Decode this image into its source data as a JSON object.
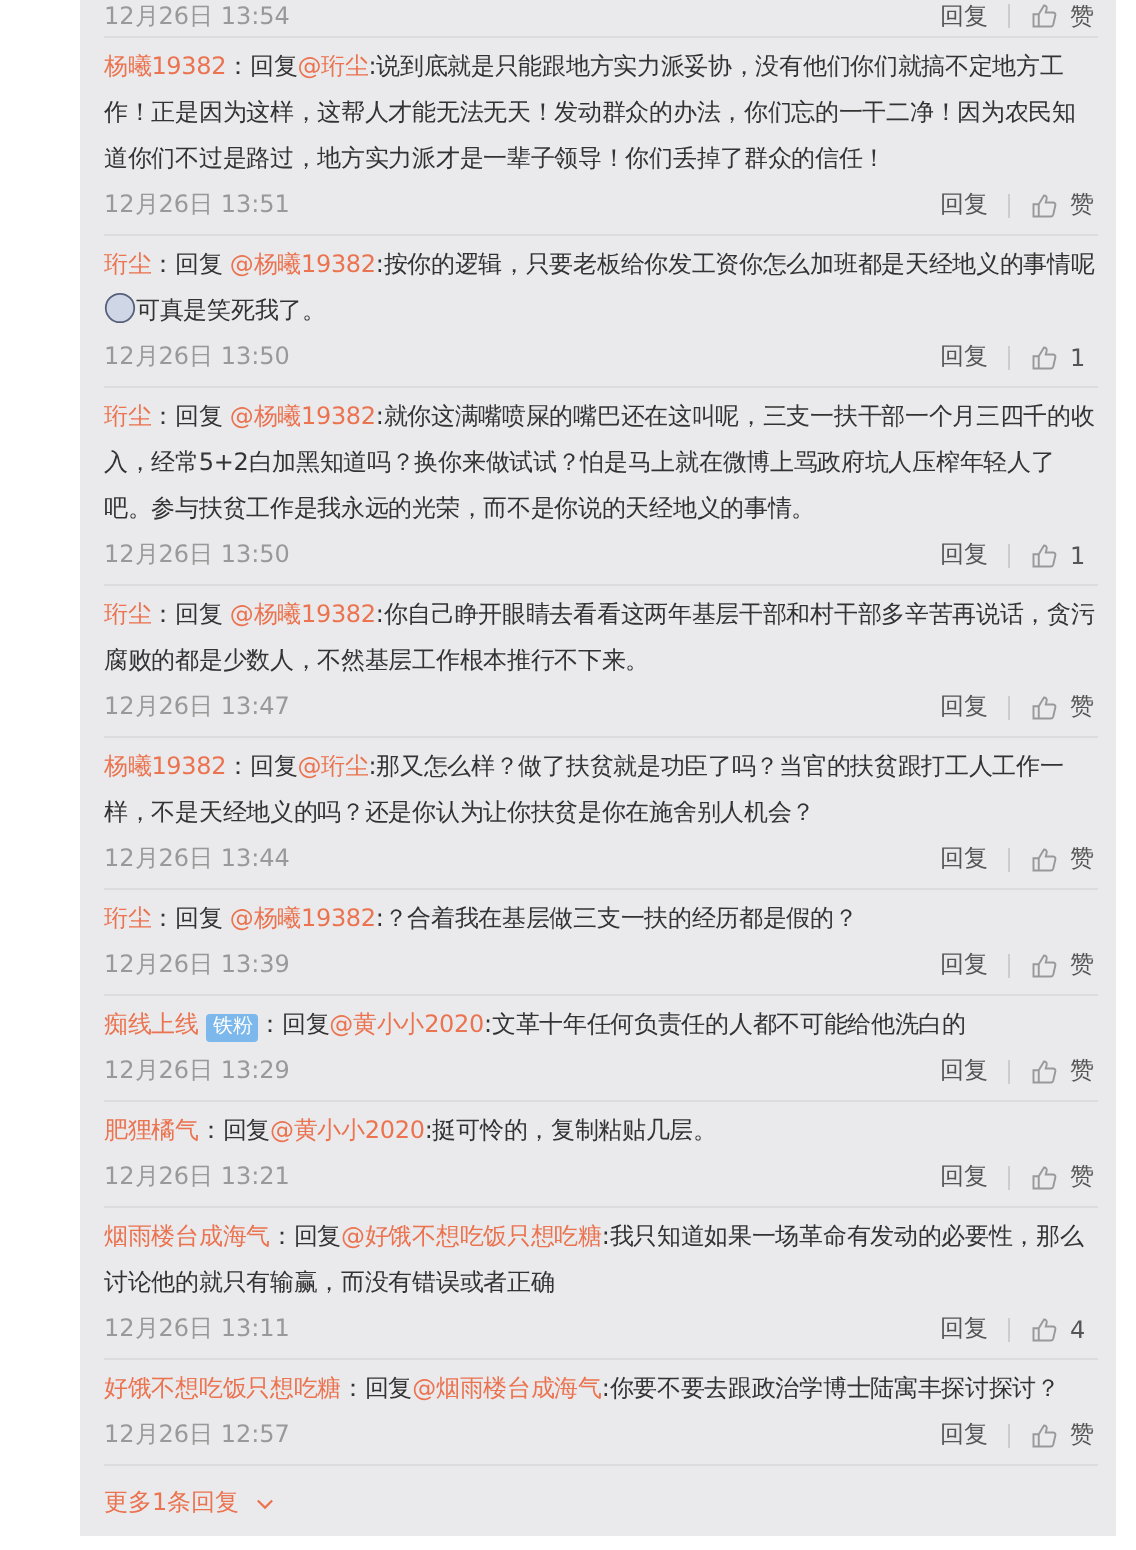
{
  "top_meta": {
    "time": "12月26日 13:54",
    "reply": "回复",
    "like": "赞"
  },
  "comments": [
    {
      "author": "杨曦19382",
      "prefix": "：回复",
      "mention": "@珩尘",
      "body": [
        {
          "kind": "text",
          "text": ":说到底就是只能跟地方实力派妥协，没有他们你们就搞不定地方工作！正是因为这样，这帮人才能无法无天！发动群众的办法，你们忘的一干二净！因为农民知道你们不过是路过，地方实力派才是一辈子领导！你们丢掉了群众的信任！"
        }
      ],
      "time": "12月26日 13:51",
      "reply": "回复",
      "like": "赞"
    },
    {
      "author": "珩尘",
      "prefix": "：回复 ",
      "mention": "@杨曦19382",
      "body": [
        {
          "kind": "text",
          "text": ":按你的逻辑，只要老板给你发工资你怎么加班都是天经地义的事情呢"
        },
        {
          "kind": "emoji"
        },
        {
          "kind": "text",
          "text": "可真是笑死我了。"
        }
      ],
      "time": "12月26日 13:50",
      "reply": "回复",
      "like": "1"
    },
    {
      "author": "珩尘",
      "prefix": "：回复 ",
      "mention": "@杨曦19382",
      "body": [
        {
          "kind": "text",
          "text": ":就你这满嘴喷屎的嘴巴还在这叫呢，三支一扶干部一个月三四千的收入，经常5+2白加黑知道吗？换你来做试试？怕是马上就在微博上骂政府坑人压榨年轻人了吧。参与扶贫工作是我永远的光荣，而不是你说的天经地义的事情。"
        }
      ],
      "time": "12月26日 13:50",
      "reply": "回复",
      "like": "1"
    },
    {
      "author": "珩尘",
      "prefix": "：回复 ",
      "mention": "@杨曦19382",
      "body": [
        {
          "kind": "text",
          "text": ":你自己睁开眼睛去看看这两年基层干部和村干部多辛苦再说话，贪污腐败的都是少数人，不然基层工作根本推行不下来。"
        }
      ],
      "time": "12月26日 13:47",
      "reply": "回复",
      "like": "赞"
    },
    {
      "author": "杨曦19382",
      "prefix": "：回复",
      "mention": "@珩尘",
      "body": [
        {
          "kind": "text",
          "text": ":那又怎么样？做了扶贫就是功臣了吗？当官的扶贫跟打工人工作一样，不是天经地义的吗？还是你认为让你扶贫是你在施舍别人机会？"
        }
      ],
      "time": "12月26日 13:44",
      "reply": "回复",
      "like": "赞"
    },
    {
      "author": "珩尘",
      "prefix": "：回复 ",
      "mention": "@杨曦19382",
      "body": [
        {
          "kind": "text",
          "text": ":？合着我在基层做三支一扶的经历都是假的？"
        }
      ],
      "time": "12月26日 13:39",
      "reply": "回复",
      "like": "赞"
    },
    {
      "author": "痴线上线",
      "badge": "铁粉",
      "prefix": "：回复",
      "mention": "@黄小小2020",
      "body": [
        {
          "kind": "text",
          "text": ":文革十年任何负责任的人都不可能给他洗白的"
        }
      ],
      "time": "12月26日 13:29",
      "reply": "回复",
      "like": "赞"
    },
    {
      "author": "肥狸橘气",
      "prefix": "：回复",
      "mention": "@黄小小2020",
      "body": [
        {
          "kind": "text",
          "text": ":挺可怜的，复制粘贴几层。"
        }
      ],
      "time": "12月26日 13:21",
      "reply": "回复",
      "like": "赞"
    },
    {
      "author": "烟雨楼台成海气",
      "prefix": "：回复",
      "mention": "@好饿不想吃饭只想吃糖",
      "body": [
        {
          "kind": "text",
          "text": ":我只知道如果一场革命有发动的必要性，那么讨论他的就只有输赢，而没有错误或者正确"
        }
      ],
      "time": "12月26日 13:11",
      "reply": "回复",
      "like": "4"
    },
    {
      "author": "好饿不想吃饭只想吃糖",
      "prefix": "：回复",
      "mention": "@烟雨楼台成海气",
      "body": [
        {
          "kind": "text",
          "text": ":你要不要去跟政治学博士陆寓丰探讨探讨？"
        }
      ],
      "time": "12月26日 12:57",
      "reply": "回复",
      "like": "赞"
    }
  ],
  "more": {
    "label": "更多1条回复"
  }
}
